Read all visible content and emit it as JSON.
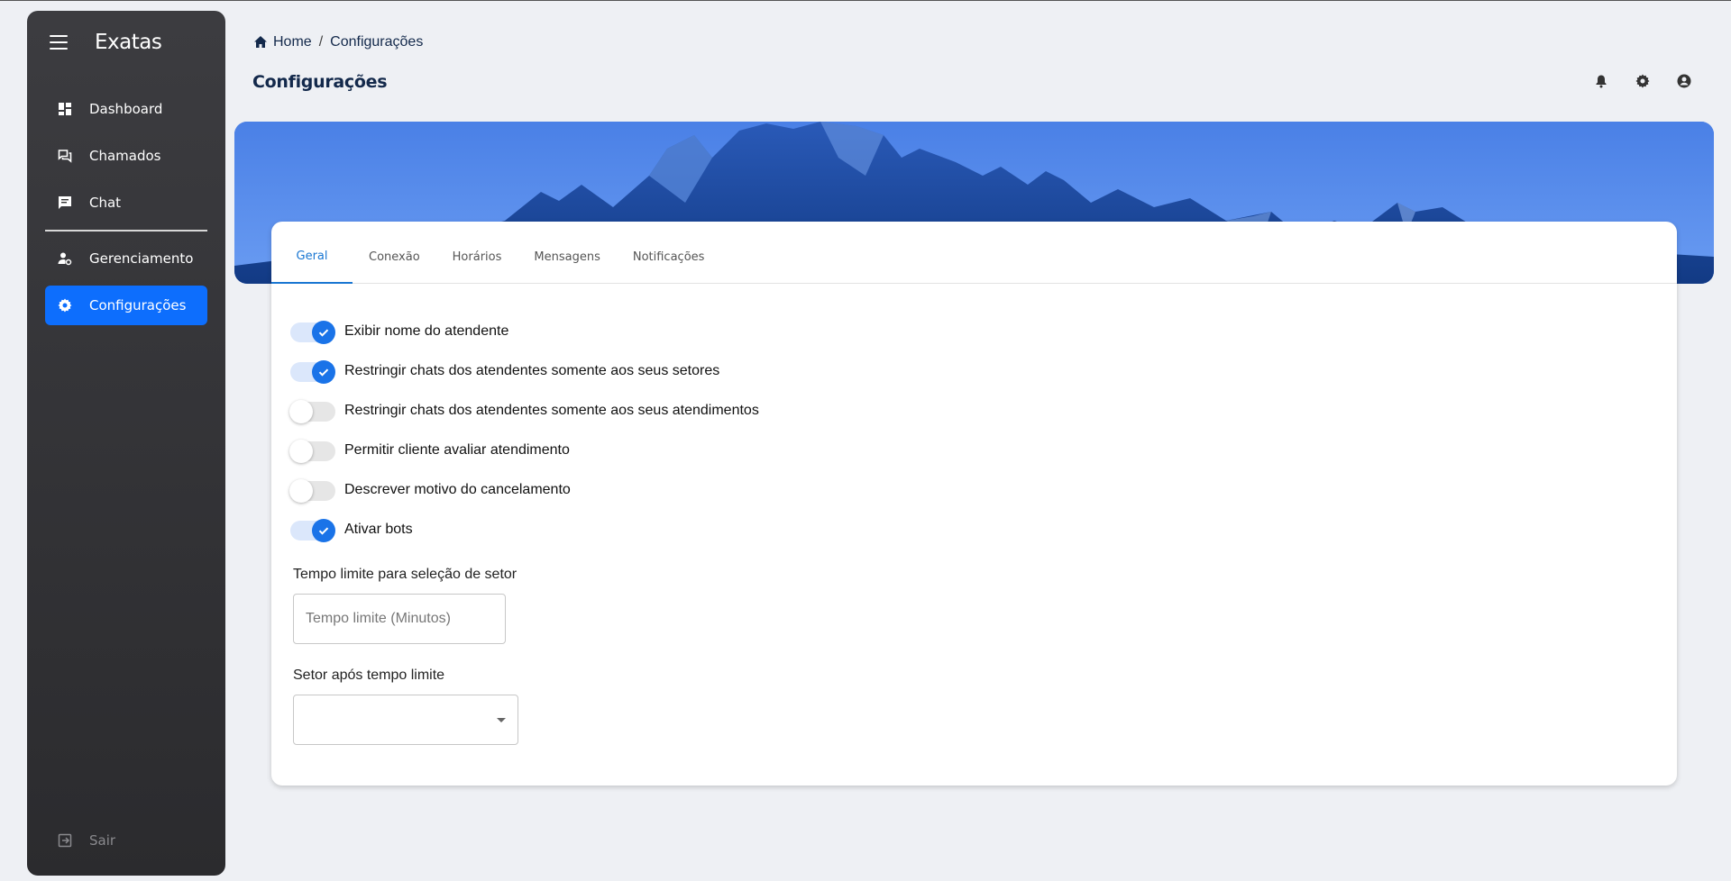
{
  "app": {
    "name": "Exatas"
  },
  "sidebar": {
    "items": [
      {
        "label": "Dashboard",
        "icon": "dashboard-icon"
      },
      {
        "label": "Chamados",
        "icon": "forum-icon"
      },
      {
        "label": "Chat",
        "icon": "chat-icon"
      },
      {
        "label": "Gerenciamento",
        "icon": "manage-accounts-icon"
      },
      {
        "label": "Configurações",
        "icon": "gear-icon",
        "active": true
      }
    ],
    "logout": {
      "label": "Sair",
      "icon": "logout-icon"
    }
  },
  "breadcrumb": {
    "home": "Home",
    "sep": "/",
    "current": "Configurações"
  },
  "header": {
    "title": "Configurações",
    "icons": [
      "bell-icon",
      "gear-icon",
      "account-circle-icon"
    ]
  },
  "tabs": [
    {
      "label": "Geral",
      "active": true
    },
    {
      "label": "Conexão"
    },
    {
      "label": "Horários"
    },
    {
      "label": "Mensagens"
    },
    {
      "label": "Notificações"
    }
  ],
  "settings": [
    {
      "label": "Exibir nome do atendente",
      "checked": true
    },
    {
      "label": "Restringir chats dos atendentes somente aos seus setores",
      "checked": true
    },
    {
      "label": "Restringir chats dos atendentes somente aos seus atendimentos",
      "checked": false
    },
    {
      "label": "Permitir cliente avaliar atendimento",
      "checked": false
    },
    {
      "label": "Descrever motivo do cancelamento",
      "checked": false
    },
    {
      "label": "Ativar bots",
      "checked": true
    }
  ],
  "timeout": {
    "label": "Tempo limite para seleção de setor",
    "placeholder": "Tempo limite (Minutos)",
    "value": ""
  },
  "sector_after": {
    "label": "Setor após tempo limite",
    "value": ""
  },
  "colors": {
    "accent": "#0d6efd",
    "switch_on": "#1a73e8",
    "sidebar_bg": "#333336",
    "title": "#13294b"
  }
}
